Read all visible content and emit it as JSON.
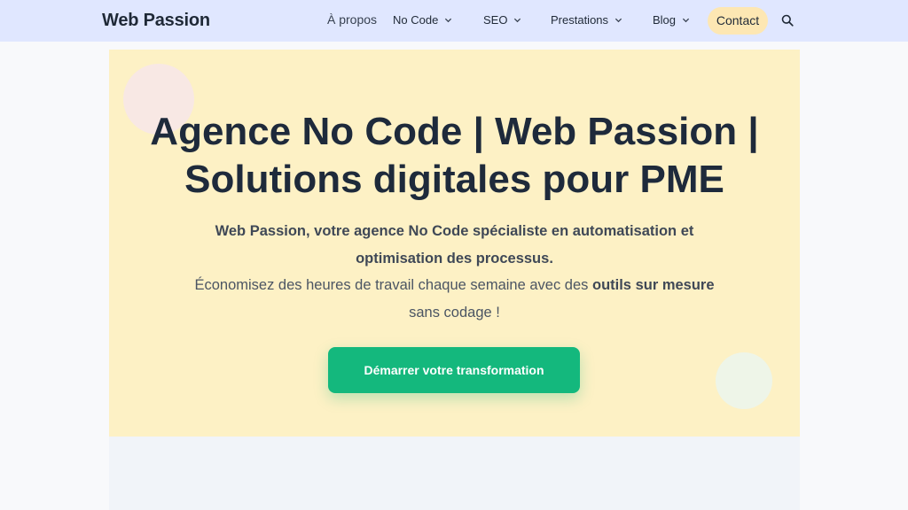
{
  "header": {
    "logo": "Web Passion",
    "nav": {
      "a_propos": "À propos",
      "no_code": "No Code",
      "seo": "SEO",
      "prestations": "Prestations",
      "blog": "Blog",
      "contact": "Contact"
    },
    "icons": {
      "dropdown": "chevron-down-icon",
      "search": "search-icon"
    }
  },
  "hero": {
    "title_line1": "Agence No Code | Web Passion |",
    "title_line2": "Solutions digitales pour PME",
    "sub_line1": "Web Passion, votre agence No Code spécialiste en automatisation et",
    "sub_line2": "optimisation des processus.",
    "sub_line3_plain": "Économisez des heures de travail chaque semaine avec des ",
    "sub_line3_bold": "outils sur mesure",
    "sub_line4": "sans codage !",
    "cta": "Démarrer votre transformation"
  },
  "colors": {
    "header_bg": "#e0e7ff",
    "hero_bg": "#fdf1c5",
    "cta_bg": "#14b87d",
    "contact_bg": "#fde7b3",
    "text_dark": "#1e2a3b"
  }
}
